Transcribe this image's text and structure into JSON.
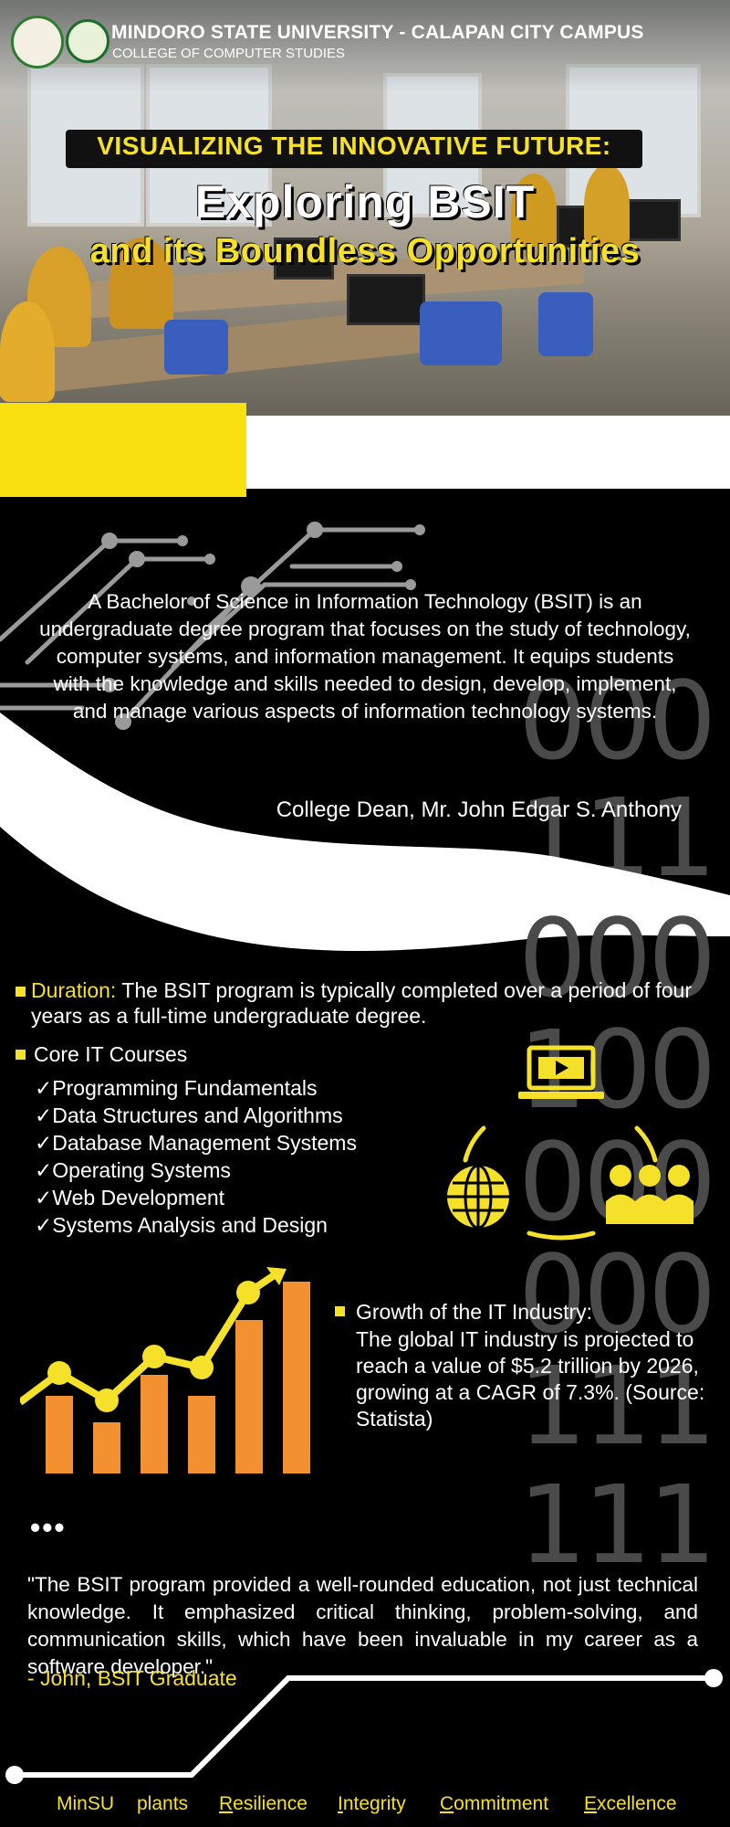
{
  "header": {
    "university": "MINDORO STATE UNIVERSITY - CALAPAN CITY CAMPUS",
    "college": "COLLEGE OF COMPUTER STUDIES",
    "tagline": "VISUALIZING THE INNOVATIVE FUTURE:",
    "headline_line1": "Exploring BSIT",
    "headline_line2": "and its Boundless Opportunities"
  },
  "intro": {
    "text": "A Bachelor of Science in Information Technology (BSIT) is an undergraduate degree program that focuses on the study of technology, computer systems, and information management. It equips students with the knowledge and skills needed to design, develop, implement, and manage various aspects of information technology systems.",
    "attribution": "College Dean, Mr. John Edgar S. Anthony"
  },
  "binary_digits": [
    "000",
    "111",
    "000",
    "100",
    "000",
    "000",
    "111",
    "111"
  ],
  "duration": {
    "label": "Duration:",
    "text": " The BSIT program is typically completed over a period of four years as a full-time undergraduate degree."
  },
  "courses": {
    "label": "Core IT Courses",
    "checkmark": "✓",
    "items": [
      "Programming Fundamentals",
      "Data Structures and Algorithms",
      "Database Management Systems",
      "Operating Systems",
      "Web Development",
      "Systems Analysis and Design"
    ]
  },
  "growth": {
    "label": "Growth of the IT Industry:",
    "text": "The global IT industry is projected to reach a value of $5.2 trillion by 2026, growing at a CAGR of 7.3%. (Source: Statista)"
  },
  "testimonial": {
    "dots": "•••",
    "quote": "\"The BSIT program provided a well-rounded education, not just technical knowledge. It emphasized critical thinking, problem-solving, and communication skills, which have been invaluable in my career as a software developer.\"",
    "attribution": "- John, BSIT Graduate"
  },
  "footer": {
    "word1": "MinSU",
    "word2": "plants",
    "values": [
      {
        "initial": "R",
        "rest": "esilience"
      },
      {
        "initial": "I",
        "rest": "ntegrity"
      },
      {
        "initial": "C",
        "rest": "ommitment"
      },
      {
        "initial": "E",
        "rest": "xcellence"
      }
    ]
  },
  "colors": {
    "accent_yellow": "#f5e02a",
    "orange": "#f39130",
    "background": "#000000"
  },
  "icons": [
    "laptop-play-icon",
    "globe-icon",
    "group-icon",
    "growth-chart-icon",
    "circuit-lines-icon"
  ]
}
